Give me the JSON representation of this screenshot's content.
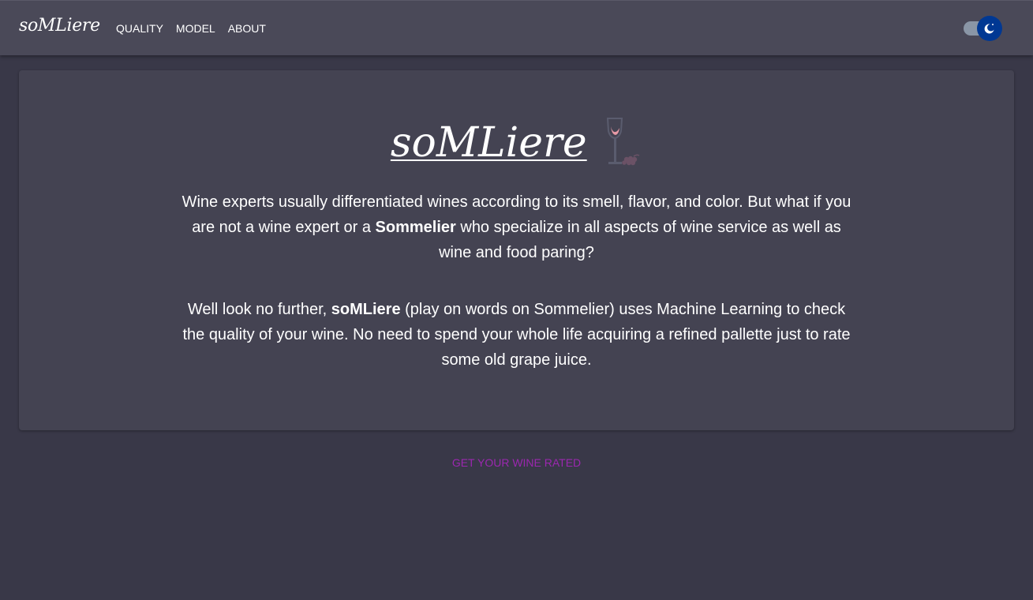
{
  "navbar": {
    "brand": "soMLiere",
    "links": [
      "QUALITY",
      "MODEL",
      "ABOUT"
    ],
    "theme_toggle": {
      "state": "dark",
      "icon": "moon-icon",
      "thumb_color": "#003893"
    }
  },
  "hero": {
    "title": "soMLiere",
    "title_icon": "wine-glass-icon",
    "paragraph1": {
      "before": "Wine experts usually differentiated wines according to its smell, flavor, and color. But what if you are not a wine expert or a ",
      "bold": "Sommelier",
      "after": " who specialize in all aspects of wine service as well as wine and food paring?"
    },
    "paragraph2": {
      "before": "Well look no further, ",
      "bold": "soMLiere",
      "after": " (play on words on Sommelier) uses Machine Learning to check the quality of your wine. No need to spend your whole life acquiring a refined pallette just to rate some old grape juice."
    }
  },
  "cta": {
    "label": "GET YOUR WINE RATED",
    "color": "#9c27b0"
  },
  "colors": {
    "page_bg": "#393848",
    "navbar_bg": "#4a4958",
    "card_bg": "#444352"
  }
}
